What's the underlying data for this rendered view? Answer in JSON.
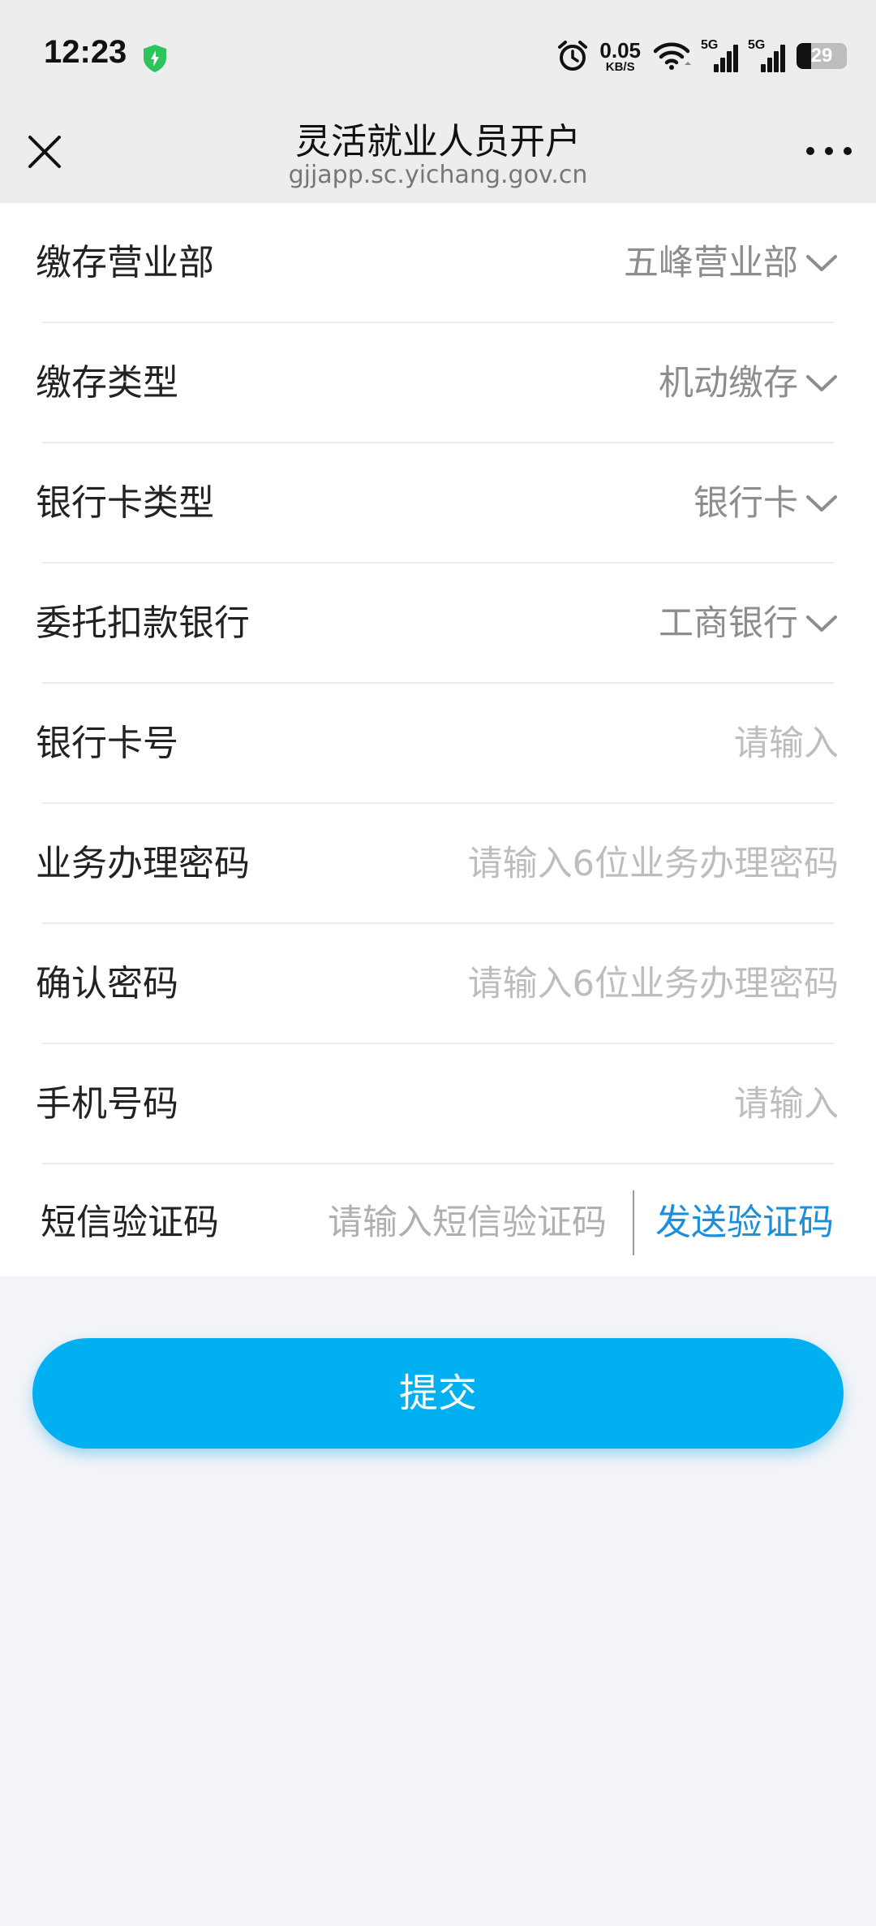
{
  "status_bar": {
    "time": "12:23",
    "net_speed_value": "0.05",
    "net_speed_unit": "KB/S",
    "signal_1_label": "5G",
    "signal_2_label": "5G",
    "battery_level": "29"
  },
  "nav": {
    "title": "灵活就业人员开户",
    "subtitle": "gjjapp.sc.yichang.gov.cn"
  },
  "form": {
    "fields": [
      {
        "label": "缴存营业部",
        "value": "五峰营业部",
        "type": "select"
      },
      {
        "label": "缴存类型",
        "value": "机动缴存",
        "type": "select"
      },
      {
        "label": "银行卡类型",
        "value": "银行卡",
        "type": "select"
      },
      {
        "label": "委托扣款银行",
        "value": "工商银行",
        "type": "select"
      },
      {
        "label": "银行卡号",
        "placeholder": "请输入",
        "type": "input"
      },
      {
        "label": "业务办理密码",
        "placeholder": "请输入6位业务办理密码",
        "type": "input"
      },
      {
        "label": "确认密码",
        "placeholder": "请输入6位业务办理密码",
        "type": "input"
      },
      {
        "label": "手机号码",
        "placeholder": "请输入",
        "type": "input"
      }
    ],
    "sms": {
      "label": "短信验证码",
      "placeholder": "请输入短信验证码",
      "send_label": "发送验证码"
    }
  },
  "submit_label": "提交",
  "colors": {
    "accent": "#00b0f0",
    "link": "#1b8fdb",
    "shield": "#2ec45c"
  }
}
